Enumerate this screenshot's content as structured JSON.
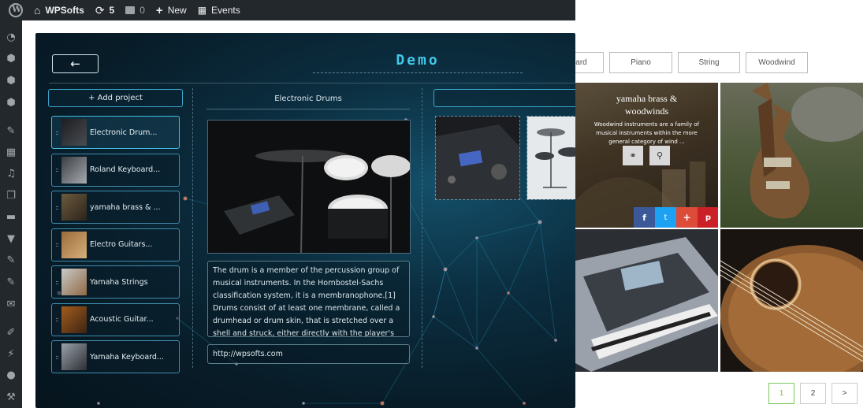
{
  "adminbar": {
    "site_name": "WPSofts",
    "updates_count": "5",
    "comments_count": "0",
    "new_label": "New",
    "events_label": "Events"
  },
  "sidebar_icons": [
    "dashboard-icon",
    "layers-icon",
    "layers-icon",
    "layers-icon",
    "pin-icon",
    "calendar-icon",
    "media-icon",
    "pages-icon",
    "comments-icon",
    "feedback-icon",
    "pin-icon",
    "pin-icon",
    "mail-icon",
    "appearance-icon",
    "plugins-icon",
    "users-icon",
    "tools-icon"
  ],
  "background": {
    "filters": [
      "ard",
      "Piano",
      "String",
      "Woodwind"
    ],
    "featured_tile": {
      "title_line1": "yamaha brass &",
      "title_line2": "woodwinds",
      "text": "Woodwind instruments are a family of musical instruments within the more general category of wind ...",
      "share_colors": [
        "#3b5998",
        "#1da1f2",
        "#dd4b39",
        "#cb2027"
      ]
    },
    "pagination": [
      "1",
      "2",
      ">"
    ]
  },
  "modal": {
    "title": "Demo",
    "back_label": "←",
    "add_project_label": "+ Add project",
    "projects": [
      {
        "name": "Electronic Drum...",
        "active": true
      },
      {
        "name": "Roland Keyboard..."
      },
      {
        "name": "yamaha brass & ..."
      },
      {
        "name": "Electro Guitars..."
      },
      {
        "name": "Yamaha Strings"
      },
      {
        "name": "Acoustic Guitar..."
      },
      {
        "name": "Yamaha Keyboard..."
      }
    ],
    "editor": {
      "title": "Electronic Drums",
      "description": "The drum is a member of the percussion group of musical instruments. In the Hornbostel-Sachs classification system, it is a membranophone.[1] Drums consist of at least one membrane, called a drumhead or drum skin, that is stretched over a shell and struck, either directly with the player's",
      "url": "http://wpsofts.com"
    },
    "accent": "#41c8e8"
  }
}
